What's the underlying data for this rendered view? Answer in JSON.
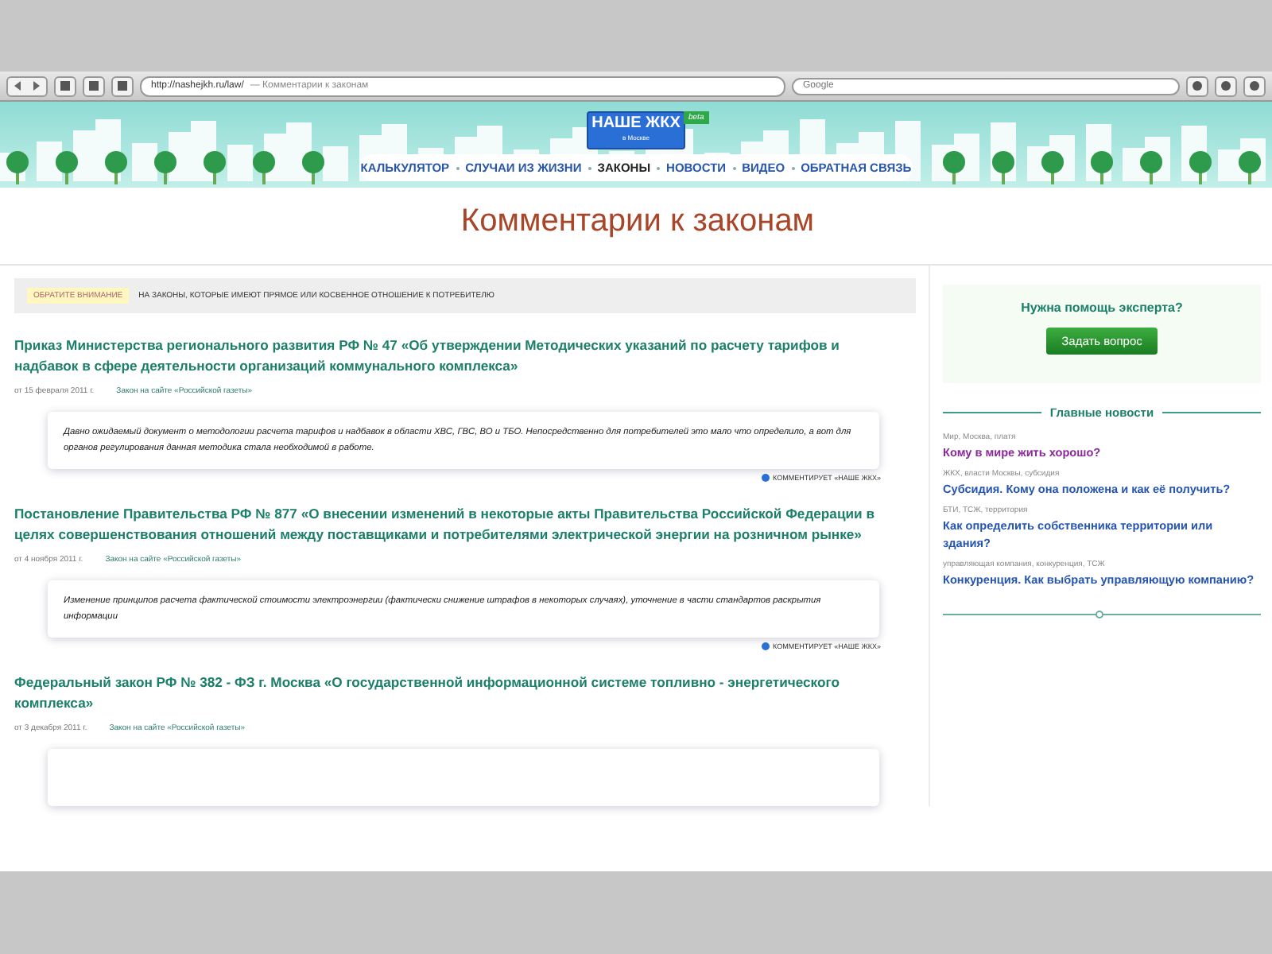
{
  "browser": {
    "url": "http://nashejkh.ru/law/",
    "page_title": "— Комментарии к законам",
    "search_placeholder": "Google"
  },
  "logo": {
    "title": "НАШЕ ЖКХ",
    "subtitle": "в Москве",
    "badge": "beta"
  },
  "nav": [
    {
      "label": "КАЛЬКУЛЯТОР",
      "selected": false
    },
    {
      "label": "СЛУЧАИ ИЗ ЖИЗНИ",
      "selected": false
    },
    {
      "label": "ЗАКОНЫ",
      "selected": true
    },
    {
      "label": "НОВОСТИ",
      "selected": false
    },
    {
      "label": "ВИДЕО",
      "selected": false
    },
    {
      "label": "ОБРАТНАЯ СВЯЗЬ",
      "selected": false
    }
  ],
  "page_title": "Комментарии к законам",
  "notice": {
    "tag": "ОБРАТИТЕ ВНИМАНИЕ",
    "text": "НА ЗАКОНЫ, КОТОРЫЕ ИМЕЮТ ПРЯМОЕ ИЛИ КОСВЕННОЕ ОТНОШЕНИЕ К ПОТРЕБИТЕЛЮ"
  },
  "laws": [
    {
      "title": "Приказ Министерства регионального развития РФ № 47 «Об утверждении Методических указаний по расчету тарифов и надбавок в сфере деятельности организаций коммунального комплекса»",
      "date": "от 15 февраля 2011 г.",
      "link": "Закон на сайте «Российской газеты»",
      "comment": "Давно ожидаемый документ о методологии расчета тарифов и надбавок в области ХВС, ГВС, ВО и ТБО. Непосредственно для потребителей это мало что определило, а вот для органов регулирования данная методика стала необходимой в работе.",
      "author": "КОММЕНТИРУЕТ «НАШЕ ЖКХ»"
    },
    {
      "title": "Постановление Правительства РФ № 877 «О внесении изменений в некоторые акты Правительства Российской Федерации в целях совершенствования отношений между поставщиками и потребителями электрической энергии на розничном рынке»",
      "date": "от 4 ноября 2011 г.",
      "link": "Закон на сайте «Российской газеты»",
      "comment": "Изменение принципов расчета фактической стоимости электроэнергии (фактически снижение штрафов в некоторых случаях), уточнение в части стандартов раскрытия информации",
      "author": "КОММЕНТИРУЕТ «НАШЕ ЖКХ»"
    },
    {
      "title": "Федеральный закон РФ № 382 - ФЗ г. Москва «О государственной информационной системе топливно - энергетического комплекса»",
      "date": "от 3 декабря 2011 г.",
      "link": "Закон на сайте «Российской газеты»"
    }
  ],
  "expert": {
    "heading": "Нужна помощь эксперта?",
    "button": "Задать вопрос"
  },
  "news": {
    "heading": "Главные новости",
    "items": [
      {
        "tags": "Мир, Москва, платя",
        "title": "Кому в мире жить хорошо?",
        "visited": true
      },
      {
        "tags": "ЖКХ, власти Москвы, субсидия",
        "title": "Субсидия. Кому она положена и как её получить?",
        "visited": false
      },
      {
        "tags": "БТИ, ТСЖ, территория",
        "title": "Как определить собственника территории или здания?",
        "visited": false
      },
      {
        "tags": "управляющая компания, конкуренция, ТСЖ",
        "title": "Конкуренция. Как выбрать управляющую компанию?",
        "visited": false
      }
    ]
  }
}
